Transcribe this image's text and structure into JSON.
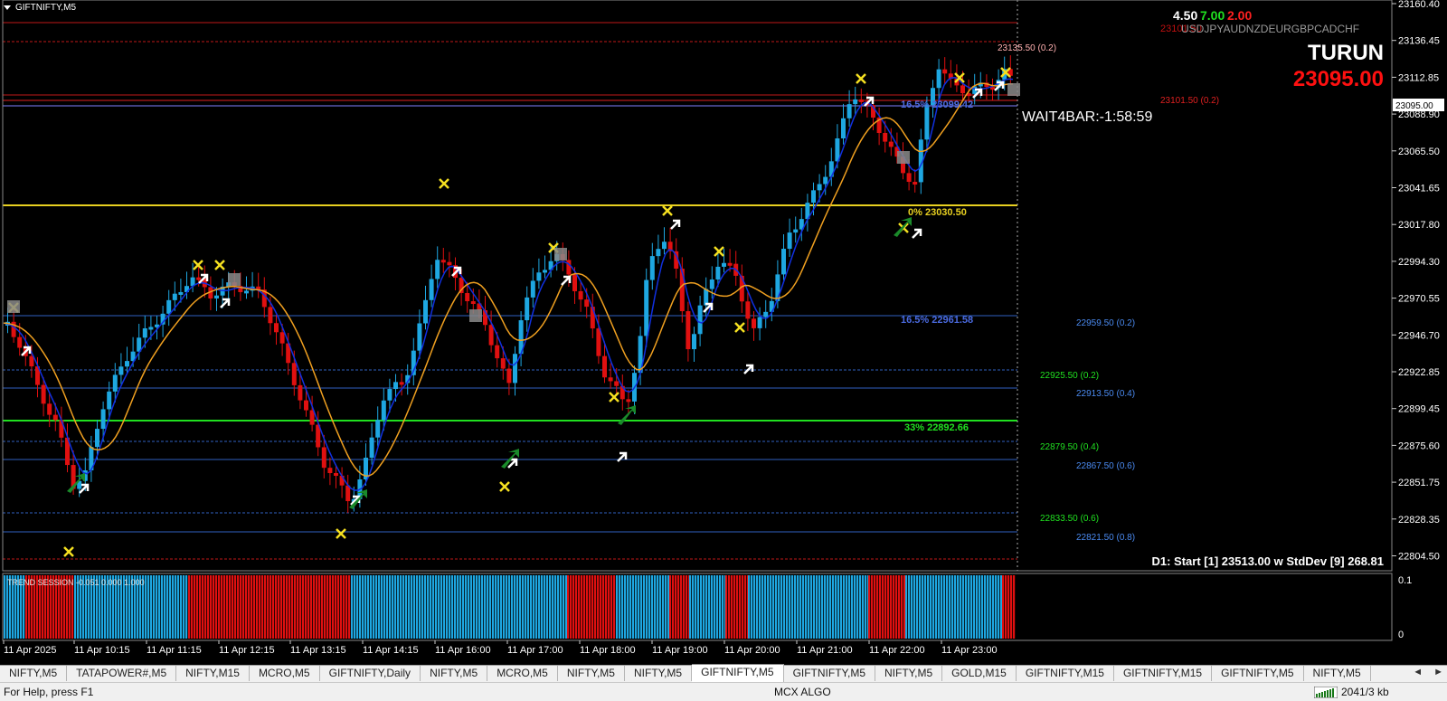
{
  "window": {
    "title": "GIFTNIFTY,M5"
  },
  "price_axis": {
    "ticks": [
      "23160.40",
      "23136.45",
      "23112.85",
      "23088.90",
      "23065.50",
      "23041.65",
      "23017.80",
      "22994.30",
      "22970.55",
      "22946.70",
      "22922.85",
      "22899.45",
      "22875.60",
      "22851.75",
      "22828.35",
      "22804.50"
    ],
    "current_price": "23095.00"
  },
  "indicator_axis": {
    "top": "0.1",
    "bottom": "0"
  },
  "time_axis": {
    "labels": [
      "11 Apr 2025",
      "11 Apr 10:15",
      "11 Apr 11:15",
      "11 Apr 12:15",
      "11 Apr 13:15",
      "11 Apr 14:15",
      "11 Apr 16:00",
      "11 Apr 17:00",
      "11 Apr 18:00",
      "11 Apr 19:00",
      "11 Apr 20:00",
      "11 Apr 21:00",
      "11 Apr 22:00",
      "11 Apr 23:00"
    ]
  },
  "overlay": {
    "score_a": "4.50",
    "score_b": "7.00",
    "score_c": "2.00",
    "currencies": "USDJPYAUDNZDEURGBPCADCHF",
    "ghost_price": "23101.50",
    "turun_label": "TURUN",
    "turun_price": "23095.00",
    "wait_label": "WAIT4BAR:-1:58:59",
    "d1_info": "D1: Start [1] 23513.00  w  StdDev [9] 268.81"
  },
  "levels": {
    "l23135": "23135.50 (0.2)",
    "l23101": "23101.50 (0.2)",
    "l22959": "22959.50 (0.2)",
    "l22925": "22925.50 (0.2)",
    "l22913": "22913.50 (0.4)",
    "l22879": "22879.50 (0.4)",
    "l22867": "22867.50 (0.6)",
    "l22833": "22833.50 (0.6)",
    "l22821": "22821.50 (0.8)"
  },
  "fibo": {
    "f0": "0%  23030.50",
    "f16a": "16.5%  23099.42",
    "f16b": "16.5%  22961.58",
    "f33": "33%  22892.66"
  },
  "indicator": {
    "label": "TREND SESSION -0.051 0.000 1.000"
  },
  "tabs": [
    "NIFTY,M5",
    "TATAPOWER#,M5",
    "NIFTY,M15",
    "MCRO,M5",
    "GIFTNIFTY,Daily",
    "NIFTY,M5",
    "MCRO,M5",
    "NIFTY,M5",
    "NIFTY,M5",
    "GIFTNIFTY,M5",
    "GIFTNIFTY,M5",
    "NIFTY,M5",
    "GOLD,M15",
    "GIFTNIFTY,M15",
    "GIFTNIFTY,M15",
    "GIFTNIFTY,M5",
    "NIFTY,M5"
  ],
  "active_tab_index": 9,
  "status": {
    "help": "For Help, press F1",
    "profile": "MCX ALGO",
    "traffic": "2041/3 kb"
  },
  "colors": {
    "bull": "#1ea7e1",
    "bear": "#e01010",
    "fast_ma": "#1030e0",
    "slow_ma": "#f0a020",
    "yellow_line": "#e8d020",
    "green_line": "#20e020"
  }
}
